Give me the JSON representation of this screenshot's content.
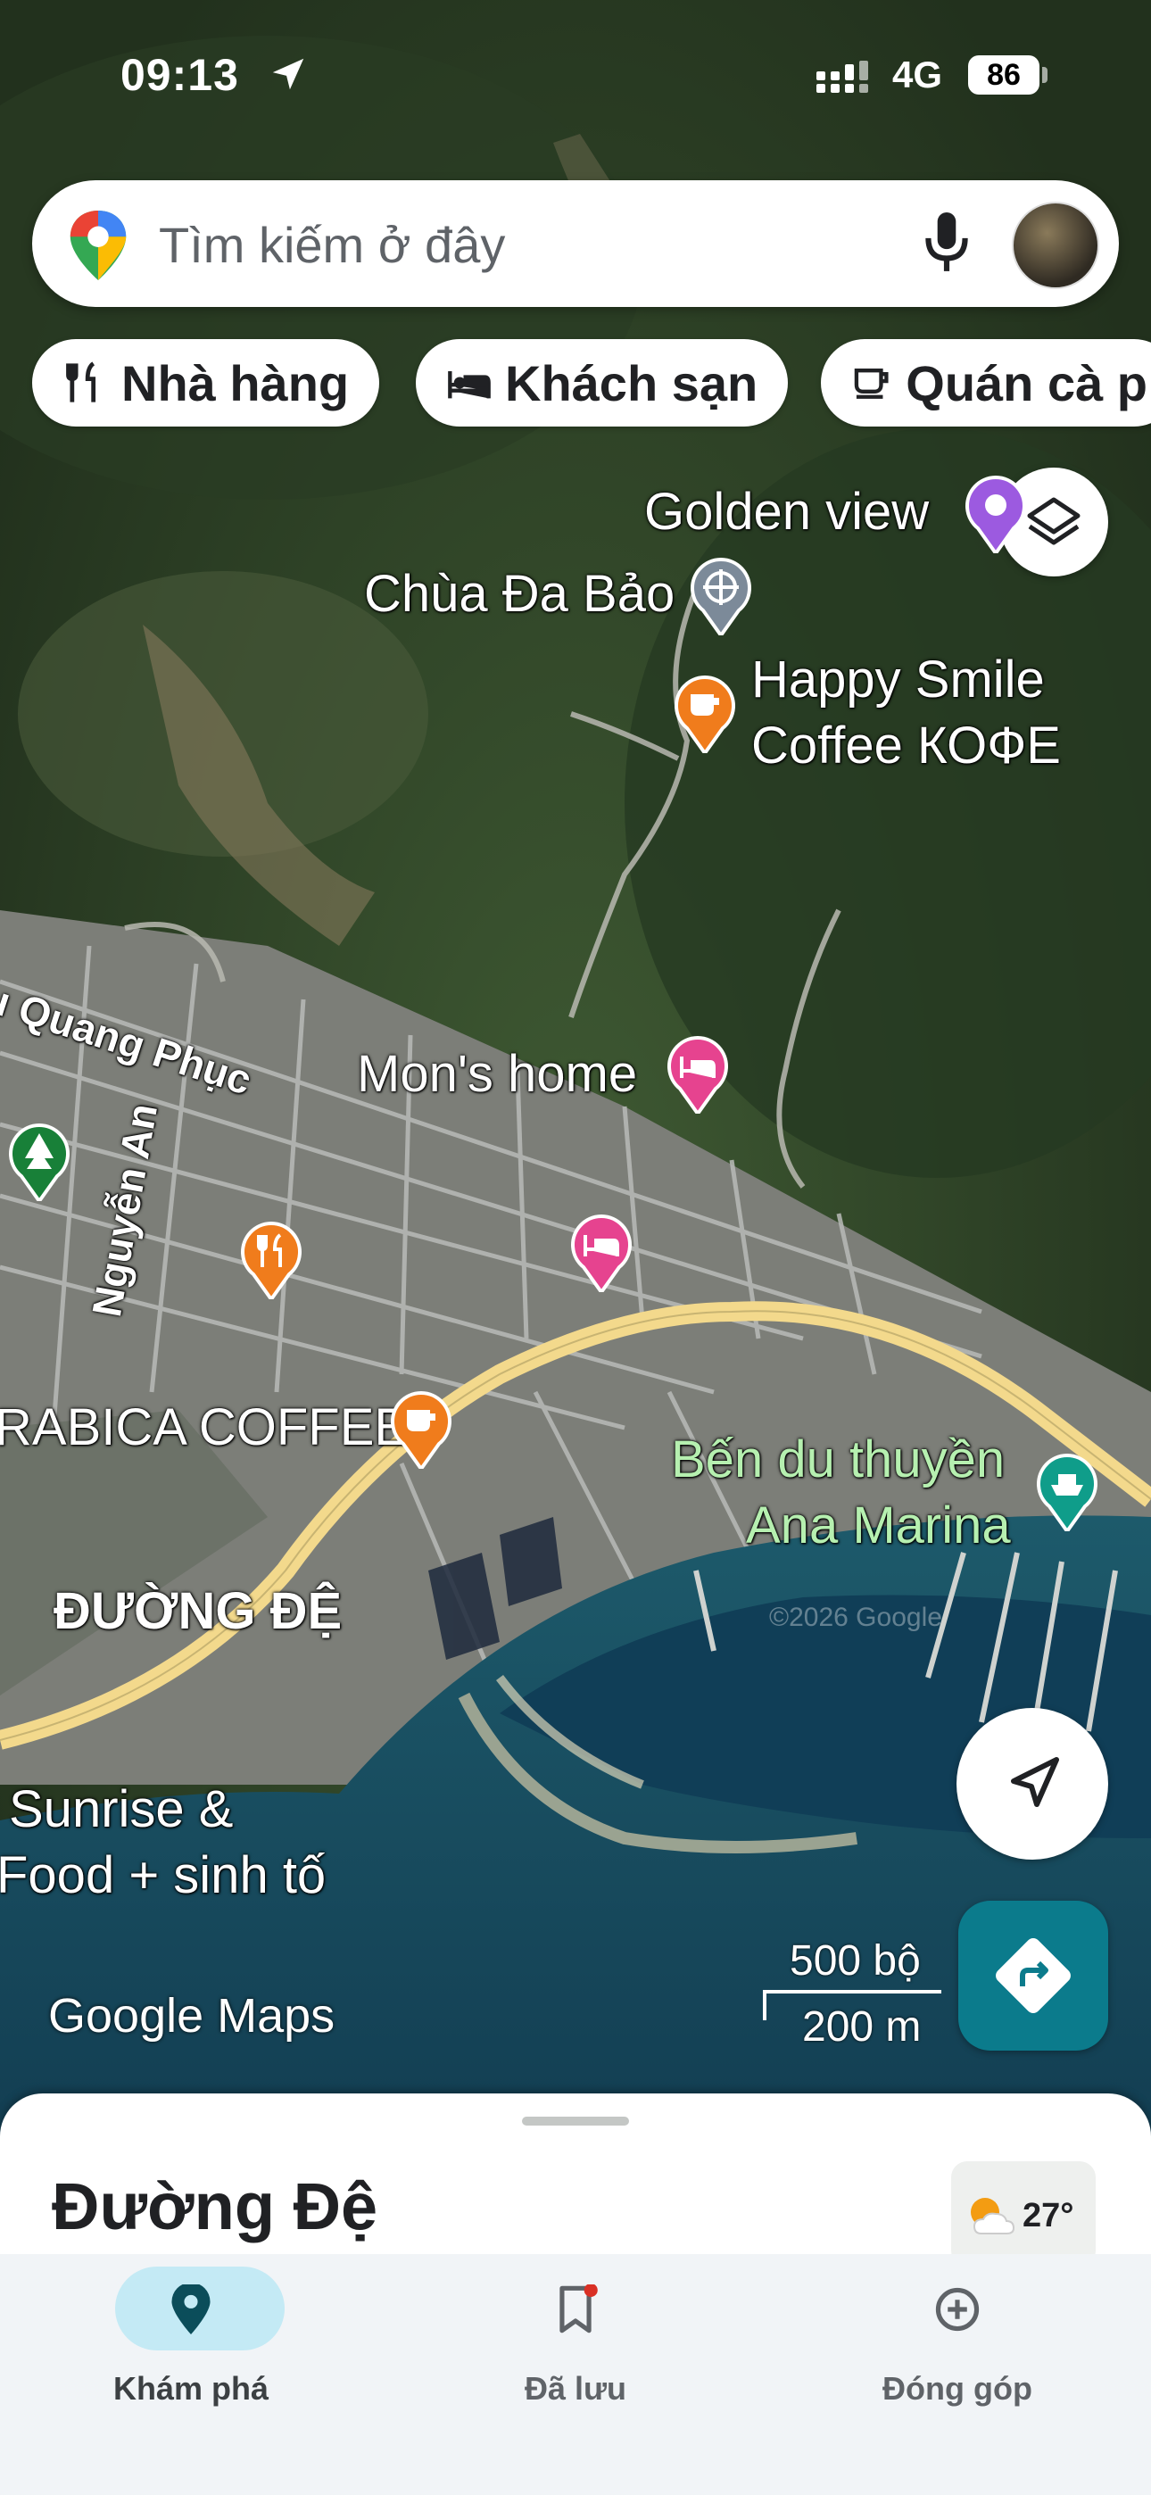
{
  "status_bar": {
    "time": "09:13",
    "network": "4G",
    "battery": "86"
  },
  "search": {
    "placeholder": "Tìm kiếm ở đây"
  },
  "chips": [
    {
      "label": "Nhà hàng",
      "icon": "fork-knife-icon"
    },
    {
      "label": "Khách sạn",
      "icon": "bed-icon"
    },
    {
      "label": "Quán cà p",
      "icon": "coffee-cup-icon"
    }
  ],
  "map_labels": {
    "golden_view": "Golden view",
    "chua_da_bao": "Chùa Đa Bảo",
    "happy_smile_1": "Happy Smile",
    "happy_smile_2": "Coffee КОФЕ",
    "street_quang_phuc": "u Quang Phục",
    "mons_home": "Mon's home",
    "street_nguyen_an": "Nguyễn An",
    "arabica": "RABICA COFFEE",
    "ben_du_thuyen_1": "Bến du thuyền",
    "ben_du_thuyen_2": "Ana Marina",
    "duong_de_area": "ĐƯỜNG ĐỆ",
    "sunrise_1": "Sunrise &",
    "sunrise_2": "Food + sinh tố",
    "watermark": "©2026 Google"
  },
  "scale": {
    "imperial": "500 bộ",
    "metric": "200 m"
  },
  "brand": "Google Maps",
  "sheet": {
    "title": "Đường Đệ",
    "temperature": "27°"
  },
  "bottom_nav": [
    {
      "label": "Khám phá",
      "icon": "explore-pin-icon",
      "active": true
    },
    {
      "label": "Đã lưu",
      "icon": "bookmark-icon",
      "active": false
    },
    {
      "label": "Đóng góp",
      "icon": "add-circle-icon",
      "active": false
    }
  ],
  "colors": {
    "accent": "#0b7b8c",
    "active_pill": "#c4eaf5",
    "road_yellow": "#f3d98c",
    "marker_orange": "#f07c1c",
    "marker_pink": "#e6438f"
  }
}
